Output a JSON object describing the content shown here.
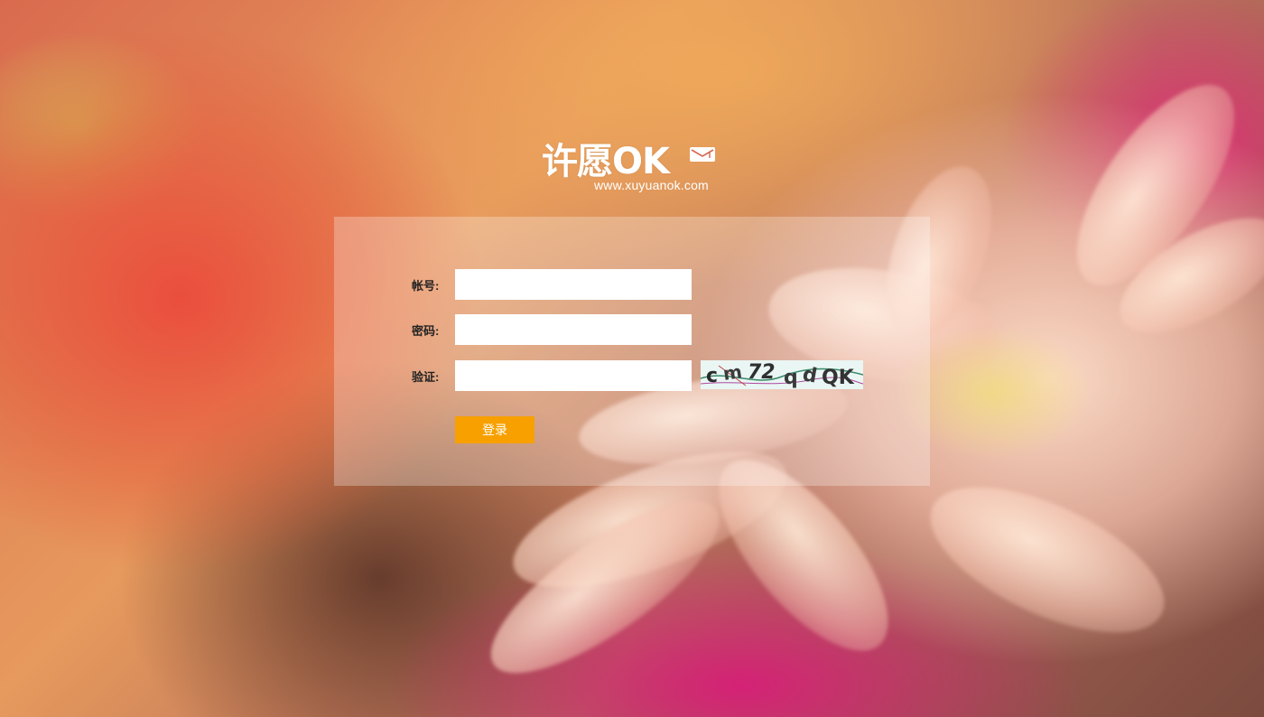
{
  "logo": {
    "brand": "许愿OK",
    "url": "www.xuyuanok.com"
  },
  "form": {
    "account_label": "帐号:",
    "account_value": "",
    "password_label": "密码:",
    "password_value": "",
    "captcha_label": "验证:",
    "captcha_value": "",
    "captcha_text": "c m 7 2 q d Q K",
    "submit_label": "登录"
  },
  "colors": {
    "submit": "#f7a000",
    "panel": "rgba(255,255,255,0.28)"
  }
}
